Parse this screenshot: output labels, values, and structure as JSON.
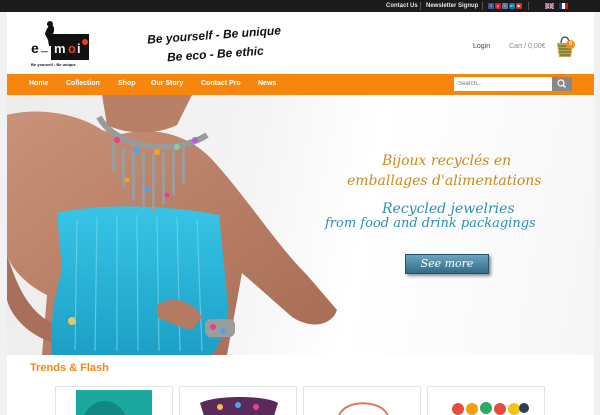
{
  "topbar": {
    "contact_us": "Contact Us",
    "newsletter": "Newsletter Signup",
    "social_icons": [
      "facebook-icon",
      "pinterest-icon",
      "instagram-icon",
      "linkedin-icon",
      "youtube-icon"
    ],
    "languages": [
      "english-flag",
      "french-flag"
    ]
  },
  "header": {
    "logo_text": "e-moi",
    "logo_tagline": "Be yourself - Be unique",
    "slogan_line1": "Be yourself - Be unique",
    "slogan_line2": "Be eco - Be ethic",
    "login": "Login",
    "cart": "Cart / 0,00€",
    "cart_count": "0"
  },
  "nav": {
    "items": [
      "Home",
      "Collection",
      "Shop",
      "Our Story",
      "Contact Pro",
      "News"
    ],
    "search_placeholder": "Search..."
  },
  "hero": {
    "fr_line1": "Bijoux recyclés en",
    "fr_line2": "emballages d'alimentations",
    "en_line1": "Recycled jewelries",
    "en_line2": "from food and drink packagings",
    "cta": "See more"
  },
  "section": {
    "title": "Trends & Flash"
  },
  "colors": {
    "accent": "#f7860f",
    "topbar": "#1b1b1b",
    "hero_text_fr": "#c98a1d",
    "hero_text_en": "#2d8fb0",
    "cta": "#2f6b8a"
  }
}
